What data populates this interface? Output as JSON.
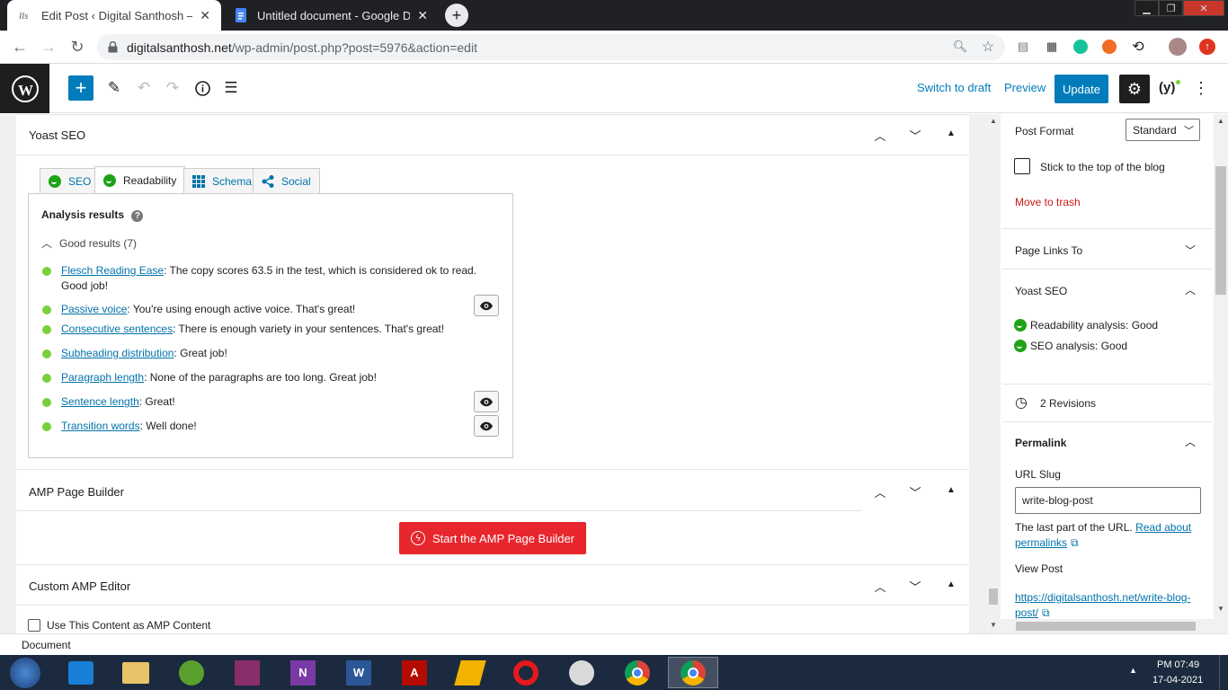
{
  "browser": {
    "tabs": [
      {
        "title": "Edit Post ‹ Digital Santhosh — W",
        "active": true
      },
      {
        "title": "Untitled document - Google Doc",
        "active": false
      }
    ],
    "url_host": "digitalsanthosh.net",
    "url_path": "/wp-admin/post.php?post=5976&action=edit"
  },
  "wp_header": {
    "switch_to_draft": "Switch to draft",
    "preview": "Preview",
    "update": "Update"
  },
  "yoast_panel": {
    "title": "Yoast SEO",
    "tabs": [
      "SEO",
      "Readability",
      "Schema",
      "Social"
    ],
    "analysis_title": "Analysis results",
    "good_results": "Good results (7)",
    "results": [
      {
        "link": "Flesch Reading Ease",
        "text": ": The copy scores 63.5 in the test, which is considered ok to read. Good job!",
        "eye": false
      },
      {
        "link": "Passive voice",
        "text": ": You're using enough active voice. That's great!",
        "eye": true
      },
      {
        "link": "Consecutive sentences",
        "text": ": There is enough variety in your sentences. That's great!",
        "eye": false
      },
      {
        "link": "Subheading distribution",
        "text": ": Great job!",
        "eye": false
      },
      {
        "link": "Paragraph length",
        "text": ": None of the paragraphs are too long. Great job!",
        "eye": false
      },
      {
        "link": "Sentence length",
        "text": ": Great!",
        "eye": true
      },
      {
        "link": "Transition words",
        "text": ": Well done!",
        "eye": true
      }
    ]
  },
  "amp_panel": {
    "title": "AMP Page Builder",
    "button": "Start the AMP Page Builder"
  },
  "custom_amp_panel": {
    "title": "Custom AMP Editor",
    "checkbox_label": "Use This Content as AMP Content"
  },
  "sidebar": {
    "post_format_label": "Post Format",
    "post_format_value": "Standard",
    "sticky_label": "Stick to the top of the blog",
    "trash": "Move to trash",
    "page_links": "Page Links To",
    "yoast_title": "Yoast SEO",
    "readability_status": "Readability analysis: Good",
    "seo_status": "SEO analysis: Good",
    "revisions": "2 Revisions",
    "permalink_title": "Permalink",
    "url_slug_label": "URL Slug",
    "url_slug_value": "write-blog-post",
    "permalink_help": "The last part of the URL.",
    "permalink_link": "Read about permalinks",
    "view_post": "View Post",
    "post_url": "https://digitalsanthosh.net/write-blog-post/"
  },
  "status": "Document",
  "taskbar": {
    "time": "PM 07:49",
    "date": "17-04-2021"
  },
  "colors": {
    "wp_blue": "#007cba",
    "yoast_good": "#7ad03a",
    "amp_red": "#e7272d",
    "trash_red": "#cc1818"
  }
}
